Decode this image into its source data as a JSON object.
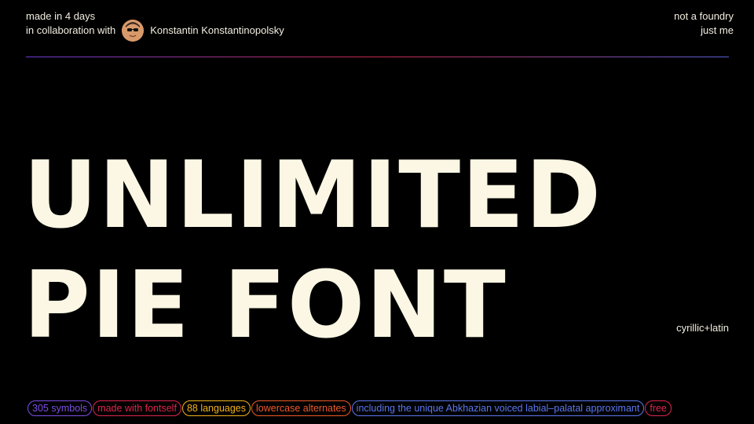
{
  "header": {
    "made_in": "made in 4 days",
    "collab_prefix": "in collaboration with",
    "collaborator": "Konstantin Konstantinopolsky",
    "foundry_line1": "not a foundry",
    "foundry_line2": "just me"
  },
  "title": {
    "line1": "UNLIMITED",
    "line2": "PIE FONT"
  },
  "script_note": "cyrillic+latin",
  "tags": [
    {
      "label": "305 symbols",
      "color": "#7b4ee6"
    },
    {
      "label": "made with fontself",
      "color": "#e0264f"
    },
    {
      "label": "88 languages",
      "color": "#f2b31c"
    },
    {
      "label": "lowercase alternates",
      "color": "#f05a2a"
    },
    {
      "label": "including the unique Abkhazian voiced labial–palatal approximant",
      "color": "#5b78f0"
    },
    {
      "label": "free",
      "color": "#e0264f"
    }
  ],
  "colors": {
    "background": "#000000",
    "title": "#fbf7e4"
  }
}
